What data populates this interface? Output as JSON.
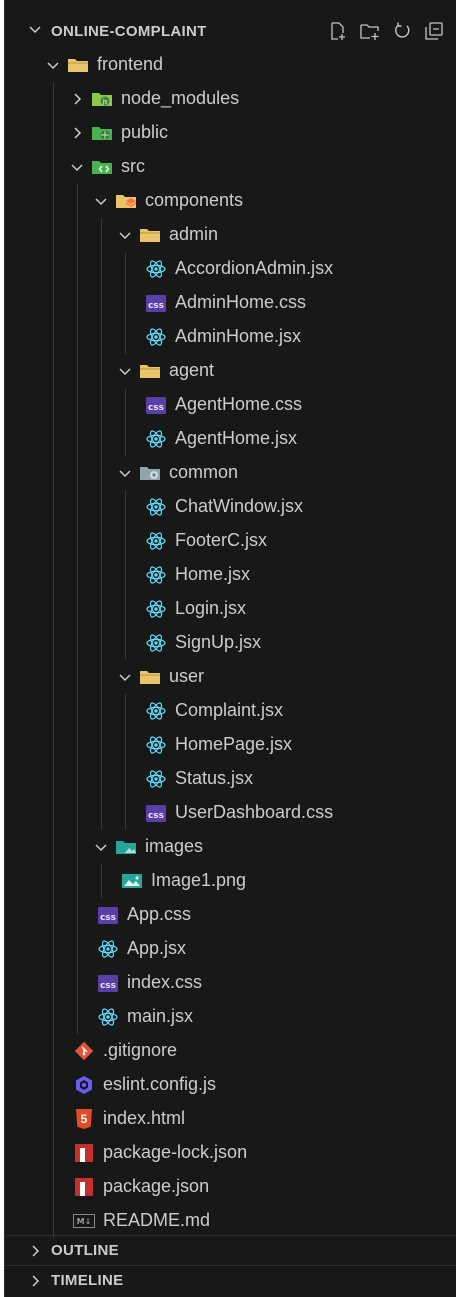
{
  "explorer": {
    "title": "ONLINE-COMPLAINT",
    "actions": [
      "new-file-icon",
      "new-folder-icon",
      "refresh-icon",
      "collapse-all-icon"
    ]
  },
  "tree": [
    {
      "label": "frontend",
      "type": "folder",
      "open": true,
      "depth": 0,
      "icon": "folder-icon"
    },
    {
      "label": "node_modules",
      "type": "folder",
      "open": false,
      "depth": 1,
      "icon": "node-folder-icon"
    },
    {
      "label": "public",
      "type": "folder",
      "open": false,
      "depth": 1,
      "icon": "public-folder-icon"
    },
    {
      "label": "src",
      "type": "folder",
      "open": true,
      "depth": 1,
      "icon": "src-folder-icon"
    },
    {
      "label": "components",
      "type": "folder",
      "open": true,
      "depth": 2,
      "icon": "components-folder-icon"
    },
    {
      "label": "admin",
      "type": "folder",
      "open": true,
      "depth": 3,
      "icon": "folder-icon"
    },
    {
      "label": "AccordionAdmin.jsx",
      "type": "file",
      "depth": 4,
      "icon": "react-icon"
    },
    {
      "label": "AdminHome.css",
      "type": "file",
      "depth": 4,
      "icon": "css-icon"
    },
    {
      "label": "AdminHome.jsx",
      "type": "file",
      "depth": 4,
      "icon": "react-icon"
    },
    {
      "label": "agent",
      "type": "folder",
      "open": true,
      "depth": 3,
      "icon": "folder-icon"
    },
    {
      "label": "AgentHome.css",
      "type": "file",
      "depth": 4,
      "icon": "css-icon"
    },
    {
      "label": "AgentHome.jsx",
      "type": "file",
      "depth": 4,
      "icon": "react-icon"
    },
    {
      "label": "common",
      "type": "folder",
      "open": true,
      "depth": 3,
      "icon": "common-folder-icon"
    },
    {
      "label": "ChatWindow.jsx",
      "type": "file",
      "depth": 4,
      "icon": "react-icon"
    },
    {
      "label": "FooterC.jsx",
      "type": "file",
      "depth": 4,
      "icon": "react-icon"
    },
    {
      "label": "Home.jsx",
      "type": "file",
      "depth": 4,
      "icon": "react-icon"
    },
    {
      "label": "Login.jsx",
      "type": "file",
      "depth": 4,
      "icon": "react-icon"
    },
    {
      "label": "SignUp.jsx",
      "type": "file",
      "depth": 4,
      "icon": "react-icon"
    },
    {
      "label": "user",
      "type": "folder",
      "open": true,
      "depth": 3,
      "icon": "folder-icon"
    },
    {
      "label": "Complaint.jsx",
      "type": "file",
      "depth": 4,
      "icon": "react-icon"
    },
    {
      "label": "HomePage.jsx",
      "type": "file",
      "depth": 4,
      "icon": "react-icon"
    },
    {
      "label": "Status.jsx",
      "type": "file",
      "depth": 4,
      "icon": "react-icon"
    },
    {
      "label": "UserDashboard.css",
      "type": "file",
      "depth": 4,
      "icon": "css-icon"
    },
    {
      "label": "images",
      "type": "folder",
      "open": true,
      "depth": 2,
      "icon": "images-folder-icon"
    },
    {
      "label": "Image1.png",
      "type": "file",
      "depth": 3,
      "icon": "image-icon"
    },
    {
      "label": "App.css",
      "type": "file",
      "depth": 2,
      "icon": "css-icon"
    },
    {
      "label": "App.jsx",
      "type": "file",
      "depth": 2,
      "icon": "react-icon"
    },
    {
      "label": "index.css",
      "type": "file",
      "depth": 2,
      "icon": "css-icon"
    },
    {
      "label": "main.jsx",
      "type": "file",
      "depth": 2,
      "icon": "react-icon"
    },
    {
      "label": ".gitignore",
      "type": "file",
      "depth": 1,
      "icon": "git-icon"
    },
    {
      "label": "eslint.config.js",
      "type": "file",
      "depth": 1,
      "icon": "eslint-icon"
    },
    {
      "label": "index.html",
      "type": "file",
      "depth": 1,
      "icon": "html-icon"
    },
    {
      "label": "package-lock.json",
      "type": "file",
      "depth": 1,
      "icon": "npm-icon"
    },
    {
      "label": "package.json",
      "type": "file",
      "depth": 1,
      "icon": "npm-icon"
    },
    {
      "label": "README.md",
      "type": "file",
      "depth": 1,
      "icon": "markdown-icon"
    }
  ],
  "sections": [
    {
      "label": "OUTLINE"
    },
    {
      "label": "TIMELINE"
    }
  ],
  "colors": {
    "background": "#181818",
    "text": "#cccccc",
    "folder": "#e8c46a",
    "react": "#61dafb",
    "css": "#5b3fa8",
    "git": "#e2553b",
    "eslint": "#6a5cf5",
    "html": "#e34c26",
    "npm": "#c4302b"
  }
}
